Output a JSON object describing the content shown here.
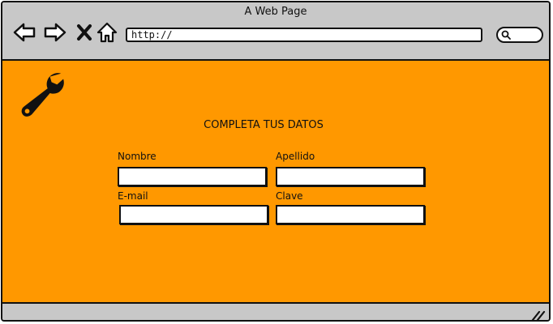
{
  "window": {
    "title": "A Web Page"
  },
  "toolbar": {
    "back_icon": "back-arrow-icon",
    "forward_icon": "forward-arrow-icon",
    "stop_icon": "close-x-icon",
    "home_icon": "home-icon",
    "url": "http://",
    "search_icon": "search-icon"
  },
  "page": {
    "logo_icon": "wrench-icon",
    "heading": "COMPLETA TUS DATOS",
    "background": "#ff9800",
    "form": {
      "nombre_label": "Nombre",
      "apellido_label": "Apellido",
      "email_label": "E-mail",
      "clave_label": "Clave"
    }
  }
}
